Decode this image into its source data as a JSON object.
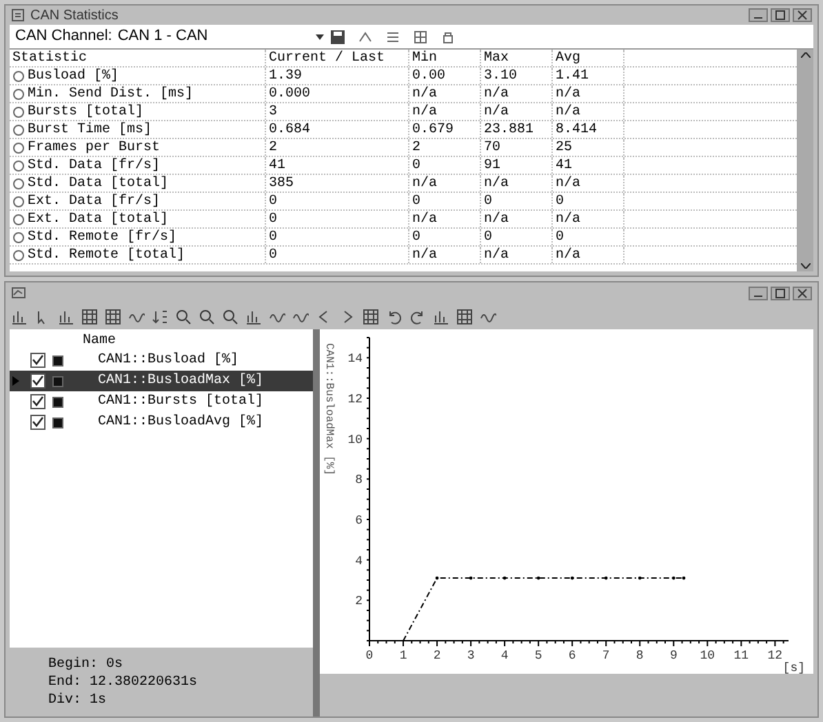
{
  "stats_window": {
    "title": "CAN Statistics",
    "channel_label": "CAN Channel:",
    "channel_value": "CAN 1 - CAN",
    "table": {
      "columns": [
        "Statistic",
        "Current / Last",
        "Min",
        "Max",
        "Avg"
      ],
      "rows": [
        [
          "Busload [%]",
          "1.39",
          "0.00",
          "3.10",
          "1.41"
        ],
        [
          "Min. Send Dist. [ms]",
          "0.000",
          "n/a",
          "n/a",
          "n/a"
        ],
        [
          "Bursts [total]",
          "3",
          "n/a",
          "n/a",
          "n/a"
        ],
        [
          "Burst Time [ms]",
          "0.684",
          "0.679",
          "23.881",
          "8.414"
        ],
        [
          "Frames per Burst",
          "2",
          "2",
          "70",
          "25"
        ],
        [
          "Std. Data [fr/s]",
          "41",
          "0",
          "91",
          "41"
        ],
        [
          "Std. Data [total]",
          "385",
          "n/a",
          "n/a",
          "n/a"
        ],
        [
          "Ext. Data [fr/s]",
          "0",
          "0",
          "0",
          "0"
        ],
        [
          "Ext. Data [total]",
          "0",
          "n/a",
          "n/a",
          "n/a"
        ],
        [
          "Std. Remote [fr/s]",
          "0",
          "0",
          "0",
          "0"
        ],
        [
          "Std. Remote [total]",
          "0",
          "n/a",
          "n/a",
          "n/a"
        ]
      ]
    }
  },
  "graph_window": {
    "signals": {
      "column": "Name",
      "items": [
        {
          "name": "CAN1::Busload [%]",
          "checked": true,
          "selected": false
        },
        {
          "name": "CAN1::BusloadMax [%]",
          "checked": true,
          "selected": true
        },
        {
          "name": "CAN1::Bursts [total]",
          "checked": true,
          "selected": false
        },
        {
          "name": "CAN1::BusloadAvg [%]",
          "checked": true,
          "selected": false
        }
      ]
    },
    "range": [
      "Begin: 0s",
      "End: 12.380220631s",
      "Div: 1s"
    ],
    "chart_data": {
      "type": "line",
      "xlabel": "[s]",
      "x": [
        1,
        2,
        3,
        4,
        5,
        6,
        7,
        8,
        9,
        9.3
      ],
      "series": [
        {
          "name": "CAN1::BusloadMax [%]",
          "color": "#000000",
          "line_style": "dashdot",
          "values": [
            0,
            3.1,
            3.1,
            3.1,
            3.1,
            3.1,
            3.1,
            3.1,
            3.1,
            3.1
          ]
        }
      ],
      "xlim": [
        0,
        12.4
      ],
      "ylim": [
        0,
        15
      ],
      "xticks": [
        0,
        1,
        2,
        3,
        4,
        5,
        6,
        7,
        8,
        9,
        10,
        11,
        12
      ],
      "yticks": [
        2,
        4,
        6,
        8,
        10,
        12,
        14
      ]
    }
  }
}
